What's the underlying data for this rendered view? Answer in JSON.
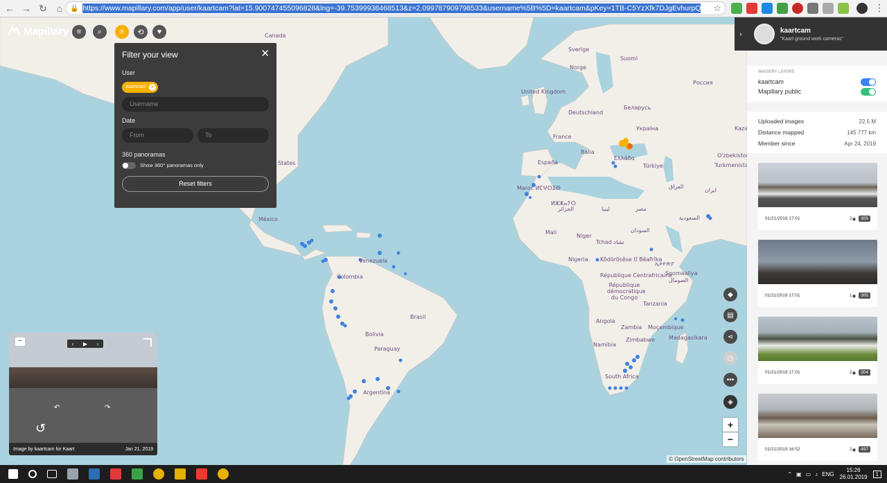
{
  "browser": {
    "url": "https://www.mapillary.com/app/user/kaartcam?lat=15.900747455096828&lng=-39.75399938468513&z=2.099787909798533&username%5B%5D=kaartcam&pKey=1TB-C5YzXfk7DJgEvhurpQ"
  },
  "app": {
    "brand": "Mapillary",
    "menu_icon": "hamburger-icon",
    "search_icon": "search-icon",
    "filter_icon": "filter-icon"
  },
  "filter": {
    "title": "Filter your view",
    "user_label": "User",
    "user_chip": "kaartcam",
    "username_placeholder": "Username",
    "date_label": "Date",
    "from_placeholder": "From",
    "to_placeholder": "To",
    "pano_label": "360 panoramas",
    "pano_toggle_label": "Show 360° panoramas only",
    "reset_label": "Reset filters"
  },
  "map_labels": [
    {
      "t": "Canada"
    },
    {
      "t": "Sverige"
    },
    {
      "t": "Suomi"
    },
    {
      "t": "Norge"
    },
    {
      "t": "Россия"
    },
    {
      "t": "United Kingdom"
    },
    {
      "t": "Deutschland"
    },
    {
      "t": "Беларусь"
    },
    {
      "t": "France"
    },
    {
      "t": "Україна"
    },
    {
      "t": "Italia"
    },
    {
      "t": "España"
    },
    {
      "t": "Türkiye"
    },
    {
      "t": "Ελλάδα"
    },
    {
      "t": "Maroc ⵍⵎⵖⵔⵉⴱ"
    },
    {
      "t": "ⵍⵣⵣⴰⵢⵔ"
    },
    {
      "t": "الجزائر"
    },
    {
      "t": "ليبيا"
    },
    {
      "t": "مصر"
    },
    {
      "t": "العراق"
    },
    {
      "t": "ایران"
    },
    {
      "t": "السعودية"
    },
    {
      "t": "Turkmenistan"
    },
    {
      "t": "O'zbekiston"
    },
    {
      "t": "Mali"
    },
    {
      "t": "Niger"
    },
    {
      "t": "Tchad تشاد"
    },
    {
      "t": "السودان"
    },
    {
      "t": "Nigeria"
    },
    {
      "t": "ኢትዮጵያ"
    },
    {
      "t": "Kôdörösêse tî Bêafrîka"
    },
    {
      "t": "République Centrafricaine"
    },
    {
      "t": "République démocratique du Congo"
    },
    {
      "t": "Soomaaliya"
    },
    {
      "t": "الصومال"
    },
    {
      "t": "Tanzania"
    },
    {
      "t": "Angola"
    },
    {
      "t": "Zambia"
    },
    {
      "t": "Moçambique"
    },
    {
      "t": "Zimbabwe"
    },
    {
      "t": "Namibia"
    },
    {
      "t": "Madagasikara"
    },
    {
      "t": "South Africa"
    },
    {
      "t": "México"
    },
    {
      "t": "Venezuela"
    },
    {
      "t": "Colombia"
    },
    {
      "t": "Brasil"
    },
    {
      "t": "Bolivia"
    },
    {
      "t": "Paraguay"
    },
    {
      "t": "Argentina"
    },
    {
      "t": "States"
    },
    {
      "t": "Kaza"
    }
  ],
  "viewer": {
    "credit": "Image by kaartcam for Kaart",
    "date": "Jan 21, 2019"
  },
  "attribution": "© OpenStreetMap contributors",
  "sidebar": {
    "username": "kaartcam",
    "description": "\"Kaart ground work cameras\"",
    "layers_title": "Imagery layers",
    "layers": [
      {
        "label": "kaartcam",
        "color": "#3b82f6"
      },
      {
        "label": "Mapillary public",
        "color": "#35c27a"
      }
    ],
    "stats": [
      {
        "label": "Uploaded images",
        "value": "22.5 M"
      },
      {
        "label": "Distance mapped",
        "value": "145 777 km"
      },
      {
        "label": "Member since",
        "value": "Apr 24, 2019"
      }
    ],
    "cards": [
      {
        "time": "01/21/2019 17:01",
        "views": "2",
        "count": "305"
      },
      {
        "time": "01/21/2019 17:01",
        "views": "1",
        "count": "305"
      },
      {
        "time": "01/21/2019 17:01",
        "views": "2",
        "count": "304"
      },
      {
        "time": "01/21/2019 16:52",
        "views": "2",
        "count": "497"
      }
    ]
  },
  "taskbar": {
    "lang": "ENG",
    "time": "15:26",
    "date": "26.01.2019",
    "notif": "1"
  }
}
